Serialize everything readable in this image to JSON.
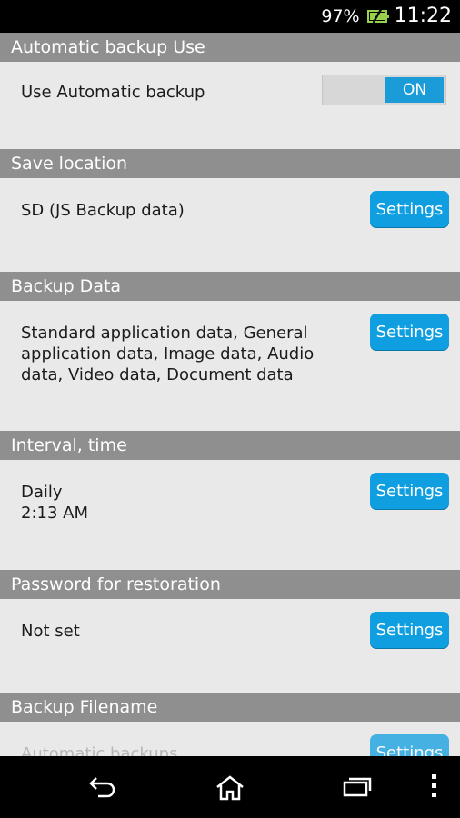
{
  "status_bar": {
    "battery_percent": "97%",
    "time": "11:22"
  },
  "sections": {
    "auto_backup": {
      "header": "Automatic backup Use",
      "label": "Use Automatic backup",
      "toggle": "ON"
    },
    "save_location": {
      "header": "Save location",
      "value": "SD (JS Backup data)",
      "button": "Settings"
    },
    "backup_data": {
      "header": "Backup Data",
      "value": "Standard application data, General application data, Image data, Audio data, Video data, Document data",
      "button": "Settings"
    },
    "interval": {
      "header": "Interval, time",
      "value_line1": "Daily",
      "value_line2": "2:13 AM",
      "button": "Settings"
    },
    "password": {
      "header": "Password for restoration",
      "value": "Not set",
      "button": "Settings"
    },
    "filename": {
      "header": "Backup Filename",
      "value": "Automatic backups",
      "button": "Settings"
    }
  },
  "icons": [
    "back-icon",
    "home-icon",
    "recents-icon",
    "menu-icon"
  ]
}
